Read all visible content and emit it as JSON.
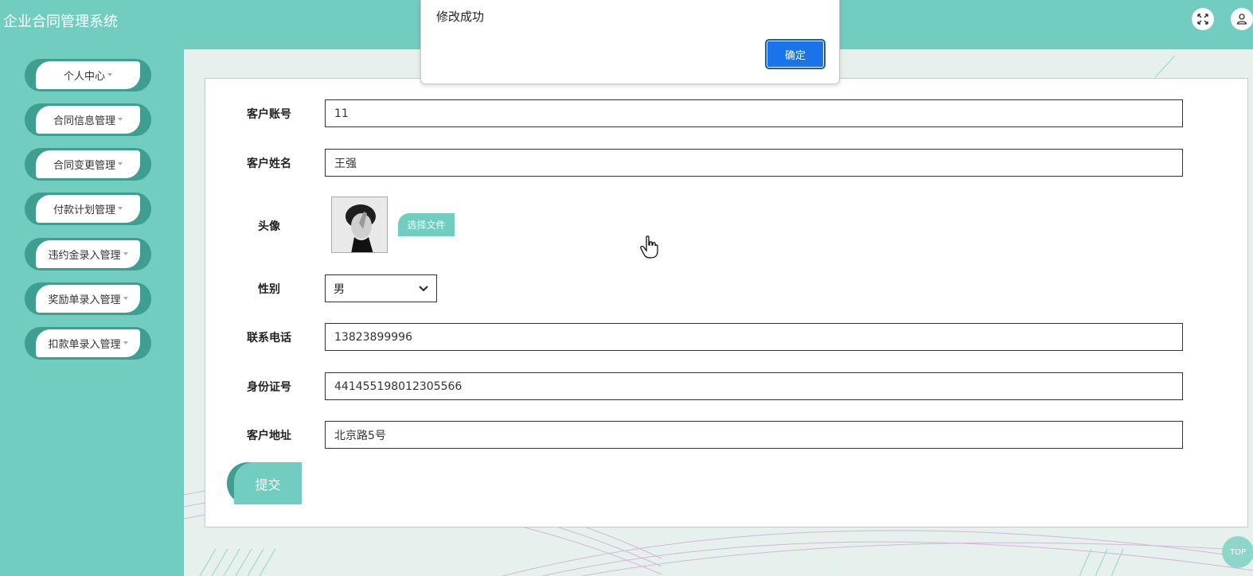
{
  "app": {
    "title": "企业合同管理系统"
  },
  "header": {
    "fullscreen_icon": "fullscreen-icon",
    "user_icon": "user-icon"
  },
  "sidebar": {
    "items": [
      {
        "label": "个人中心"
      },
      {
        "label": "合同信息管理"
      },
      {
        "label": "合同变更管理"
      },
      {
        "label": "付款计划管理"
      },
      {
        "label": "违约金录入管理"
      },
      {
        "label": "奖励单录入管理"
      },
      {
        "label": "扣款单录入管理"
      }
    ]
  },
  "form": {
    "fields": {
      "account": {
        "label": "客户账号",
        "value": "11"
      },
      "name": {
        "label": "客户姓名",
        "value": "王强"
      },
      "avatar": {
        "label": "头像",
        "button": "选择文件"
      },
      "gender": {
        "label": "性别",
        "value": "男"
      },
      "phone": {
        "label": "联系电话",
        "value": "13823899996"
      },
      "idcard": {
        "label": "身份证号",
        "value": "441455198012305566"
      },
      "address": {
        "label": "客户地址",
        "value": "北京路5号"
      }
    },
    "submit_label": "提交"
  },
  "dialog": {
    "message": "修改成功",
    "ok_label": "确定"
  },
  "back_to_top": {
    "label": "TOP"
  },
  "colors": {
    "primary": "#71cdbf",
    "primary_dark": "#3e9e90",
    "dialog_button": "#1a73e8"
  }
}
